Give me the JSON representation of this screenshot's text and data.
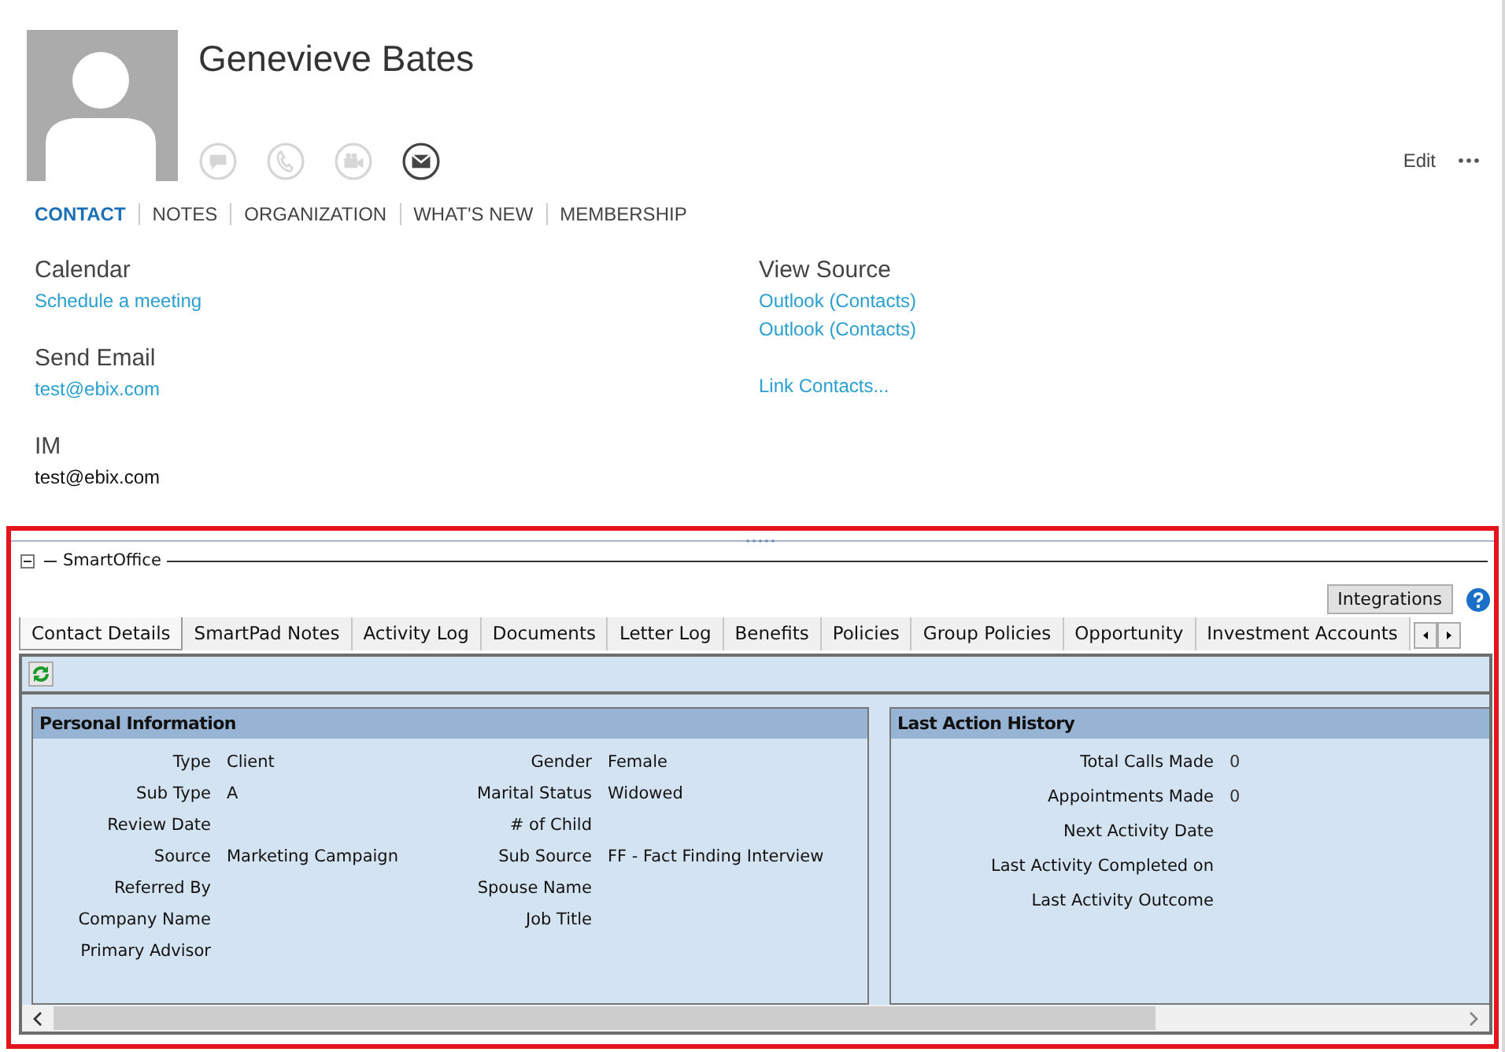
{
  "contact": {
    "name": "Genevieve Bates",
    "actions": [
      {
        "kind": "chat",
        "disabled": true
      },
      {
        "kind": "phone",
        "disabled": true
      },
      {
        "kind": "video",
        "disabled": true
      },
      {
        "kind": "mail",
        "disabled": false
      }
    ],
    "edit": "Edit"
  },
  "nav_tabs": [
    {
      "label": "CONTACT",
      "selected": true
    },
    {
      "label": "NOTES",
      "selected": false
    },
    {
      "label": "ORGANIZATION",
      "selected": false
    },
    {
      "label": "WHAT'S NEW",
      "selected": false
    },
    {
      "label": "MEMBERSHIP",
      "selected": false
    }
  ],
  "left_sections": [
    {
      "title": "Calendar",
      "items": [
        {
          "text": "Schedule a meeting",
          "kind": "link"
        }
      ]
    },
    {
      "title": "Send Email",
      "items": [
        {
          "text": "test@ebix.com",
          "kind": "link"
        }
      ]
    },
    {
      "title": "IM",
      "items": [
        {
          "text": "test@ebix.com",
          "kind": "plain"
        }
      ]
    }
  ],
  "right_sections": [
    {
      "title": "View Source",
      "items": [
        {
          "text": "Outlook (Contacts)",
          "kind": "link"
        },
        {
          "text": "Outlook (Contacts)",
          "kind": "link"
        }
      ]
    },
    {
      "items": [
        {
          "text": "Link Contacts...",
          "kind": "link"
        }
      ]
    }
  ],
  "smartoffice": {
    "title": "SmartOffice",
    "integrations": "Integrations",
    "tabs": [
      {
        "label": "Contact Details",
        "selected": true
      },
      {
        "label": "SmartPad Notes",
        "selected": false
      },
      {
        "label": "Activity Log",
        "selected": false
      },
      {
        "label": "Documents",
        "selected": false
      },
      {
        "label": "Letter Log",
        "selected": false
      },
      {
        "label": "Benefits",
        "selected": false
      },
      {
        "label": "Policies",
        "selected": false
      },
      {
        "label": "Group Policies",
        "selected": false
      },
      {
        "label": "Opportunity",
        "selected": false
      },
      {
        "label": "Investment Accounts",
        "selected": false
      }
    ],
    "personal_information": {
      "title": "Personal Information",
      "columns": [
        [
          {
            "label": "Type",
            "value": "Client"
          },
          {
            "label": "Sub Type",
            "value": "A"
          },
          {
            "label": "Review Date"
          },
          {
            "label": "Source",
            "value": "Marketing Campaign"
          },
          {
            "label": "Referred By"
          },
          {
            "label": "Company Name"
          },
          {
            "label": "Primary Advisor"
          }
        ],
        [
          {
            "label": "Gender",
            "value": "Female"
          },
          {
            "label": "Marital Status",
            "value": "Widowed"
          },
          {
            "label": "# of Child"
          },
          {
            "label": "Sub Source",
            "value": "FF - Fact Finding Interview"
          },
          {
            "label": "Spouse Name"
          },
          {
            "label": "Job Title"
          }
        ]
      ]
    },
    "last_action_history": {
      "title": "Last Action History",
      "fields": [
        {
          "label": "Total Calls Made",
          "value": "0"
        },
        {
          "label": "Appointments Made",
          "value": "0"
        },
        {
          "label": "Next Activity Date"
        },
        {
          "label": "Last Activity Completed on"
        },
        {
          "label": "Last Activity Outcome"
        }
      ]
    }
  }
}
